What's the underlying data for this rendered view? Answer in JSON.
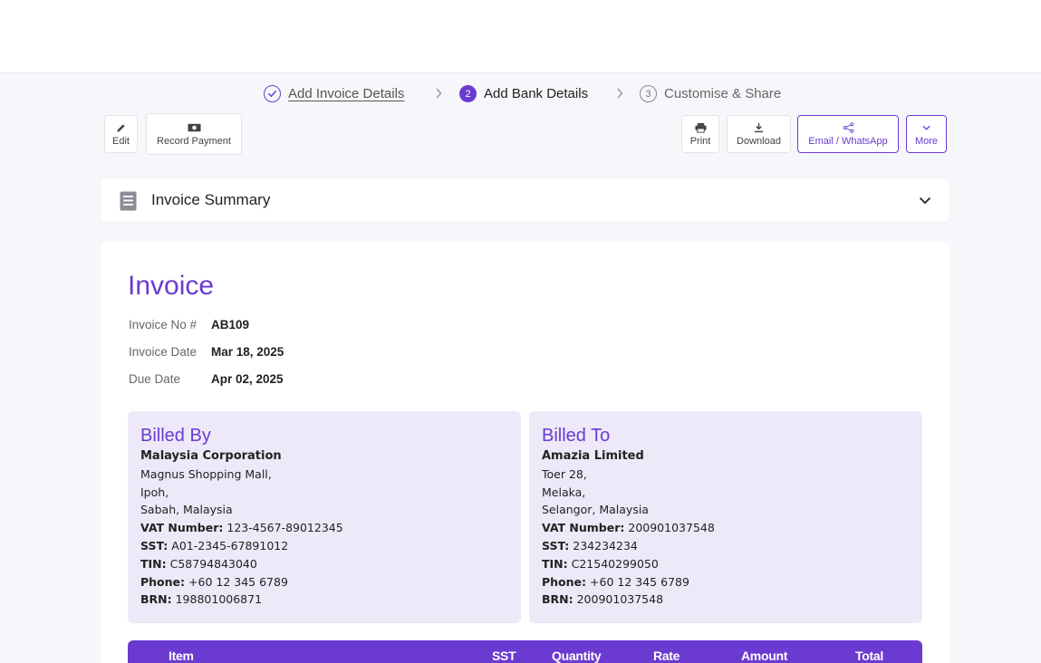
{
  "stepper": {
    "steps": [
      {
        "number": "✓",
        "label": "Add Invoice Details",
        "state": "completed"
      },
      {
        "number": "2",
        "label": "Add Bank Details",
        "state": "active"
      },
      {
        "number": "3",
        "label": "Customise & Share",
        "state": "pending"
      }
    ]
  },
  "toolbar": {
    "edit_label": "Edit",
    "record_payment_label": "Record Payment",
    "print_label": "Print",
    "download_label": "Download",
    "share_label": "Email / WhatsApp",
    "more_label": "More"
  },
  "summary": {
    "title": "Invoice Summary"
  },
  "invoice": {
    "title": "Invoice",
    "meta": [
      {
        "label": "Invoice No #",
        "value": "AB109"
      },
      {
        "label": "Invoice Date",
        "value": "Mar 18, 2025"
      },
      {
        "label": "Due Date",
        "value": "Apr 02, 2025"
      }
    ]
  },
  "billed_by": {
    "title": "Billed By",
    "name": "Malaysia Corporation",
    "address": [
      "Magnus Shopping Mall,",
      "Ipoh,",
      "Sabah, Malaysia"
    ],
    "fields": [
      {
        "label": "VAT Number:",
        "value": "123-4567-89012345"
      },
      {
        "label": "SST:",
        "value": "A01-2345-67891012"
      },
      {
        "label": "TIN:",
        "value": "C58794843040"
      },
      {
        "label": "Phone:",
        "value": "+60 12 345 6789"
      },
      {
        "label": "BRN:",
        "value": "198801006871"
      }
    ]
  },
  "billed_to": {
    "title": "Billed To",
    "name": "Amazia Limited",
    "address": [
      "Toer 28,",
      "Melaka,",
      "Selangor, Malaysia"
    ],
    "fields": [
      {
        "label": "VAT Number:",
        "value": "200901037548"
      },
      {
        "label": "SST:",
        "value": "234234234"
      },
      {
        "label": "TIN:",
        "value": "C21540299050"
      },
      {
        "label": "Phone:",
        "value": "+60 12 345 6789"
      },
      {
        "label": "BRN:",
        "value": "200901037548"
      }
    ]
  },
  "table": {
    "headers": [
      "Item",
      "SST",
      "Quantity",
      "Rate",
      "Amount",
      "Total"
    ]
  },
  "colors": {
    "accent": "#6b3bd1",
    "panel": "#ede9f8",
    "background": "#f6f7fa"
  }
}
